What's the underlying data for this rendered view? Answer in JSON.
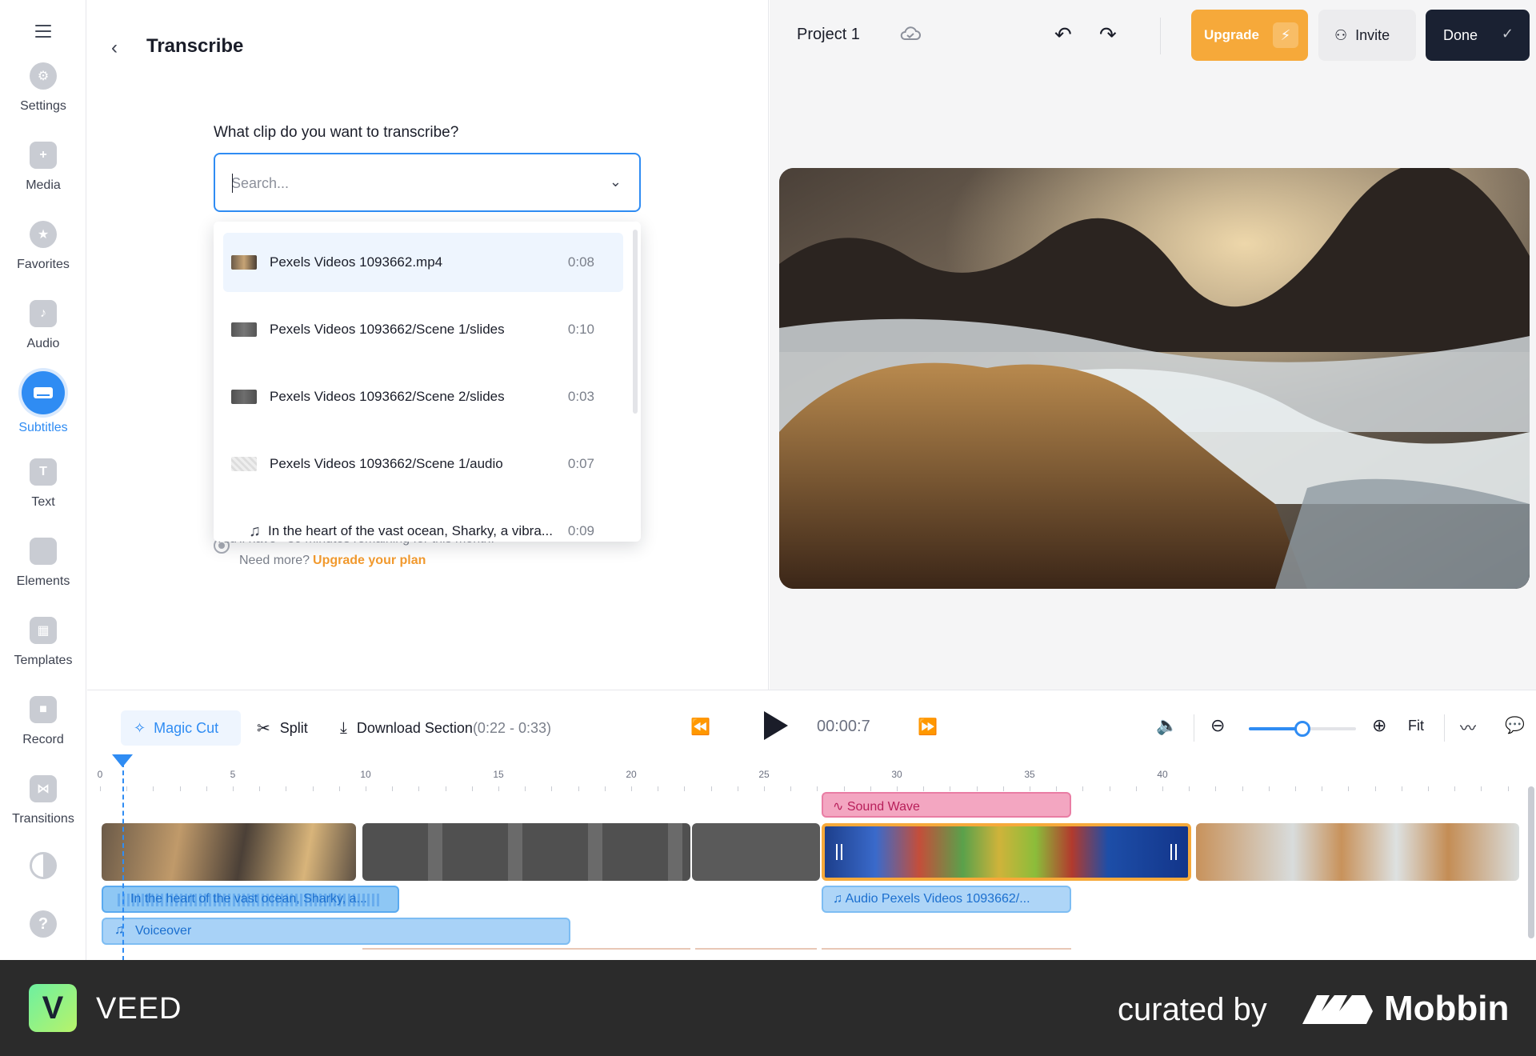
{
  "sidebar": {
    "items": [
      {
        "label": "Settings",
        "icon": "gear-icon"
      },
      {
        "label": "Media",
        "icon": "plus-icon"
      },
      {
        "label": "Favorites",
        "icon": "star-icon"
      },
      {
        "label": "Audio",
        "icon": "music-note-icon"
      },
      {
        "label": "Subtitles",
        "icon": "subtitles-icon",
        "active": true
      },
      {
        "label": "Text",
        "icon": "text-t-icon"
      },
      {
        "label": "Elements",
        "icon": "shapes-icon"
      },
      {
        "label": "Templates",
        "icon": "layout-icon"
      },
      {
        "label": "Record",
        "icon": "camera-icon"
      },
      {
        "label": "Transitions",
        "icon": "bowtie-icon"
      }
    ]
  },
  "panel": {
    "title": "Transcribe",
    "question": "What clip do you want to transcribe?",
    "search_placeholder": "Search...",
    "clips": [
      {
        "name": "Pexels Videos 1093662.mp4",
        "duration": "0:08",
        "selected": true
      },
      {
        "name": "Pexels Videos 1093662/Scene 1/slides",
        "duration": "0:10"
      },
      {
        "name": "Pexels Videos 1093662/Scene 2/slides",
        "duration": "0:03"
      },
      {
        "name": "Pexels Videos 1093662/Scene 1/audio",
        "duration": "0:07"
      },
      {
        "name": "In the heart of the vast ocean, Sharky, a vibra...",
        "duration": "0:09"
      }
    ],
    "remaining_text": "You'll have ~30 minutes remaining for this month.",
    "need_more": "Need more?",
    "upgrade_link": "Upgrade your plan"
  },
  "header": {
    "project_name": "Project 1",
    "upgrade_label": "Upgrade",
    "invite_label": "Invite",
    "done_label": "Done"
  },
  "timeline": {
    "magic_cut_label": "Magic Cut",
    "split_label": "Split",
    "download_label": "Download Section",
    "download_range": "(0:22 - 0:33)",
    "timecode": "00:00:7",
    "fit_label": "Fit",
    "zoom_level": 0.5,
    "ruler_ticks": [
      "0",
      "5",
      "10",
      "15",
      "20",
      "25",
      "30",
      "35",
      "40"
    ],
    "clips": {
      "sound_wave": "Sound Wave",
      "audio_main": "In the heart of the vast ocean, Sharky, a...",
      "audio_pexels": "Audio Pexels Videos 1093662/...",
      "voiceover": "Voiceover"
    }
  },
  "footer": {
    "brand": "VEED",
    "brand_mark": "V",
    "curated_by": "curated by",
    "mobbin": "Mobbin"
  },
  "colors": {
    "accent": "#2f8cf3",
    "upgrade": "#f6a93a",
    "done": "#1a2132",
    "sound_wave": "#f3a6c1"
  }
}
